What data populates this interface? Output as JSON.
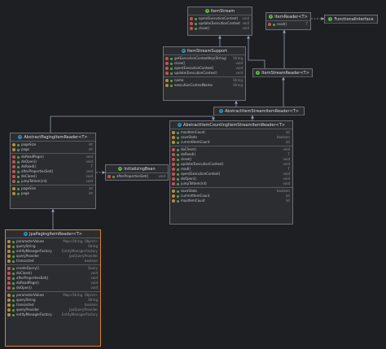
{
  "colors": {
    "background": "#1e1f22",
    "box": "#2b2d30",
    "border": "#6b6f76",
    "focus_border": "#d9822b",
    "edge": "#8fa0b8",
    "method_icon": "#c75450",
    "field_icon": "#b88c3b",
    "interface_icon": "#62b543",
    "class_icon": "#3592c4"
  },
  "icons": {
    "interface": "green-circle-icon",
    "class": "blue-circle-icon",
    "method": "red-circle-method-icon",
    "field": "orange-circle-field-icon"
  },
  "boxes": {
    "item_stream": {
      "title": "ItemStream",
      "sections": [
        [
          {
            "kind": "m",
            "name": "open(ExecutionContext)",
            "type": "void"
          },
          {
            "kind": "m",
            "name": "update(ExecutionContext)",
            "type": "void"
          },
          {
            "kind": "m",
            "name": "close()",
            "type": "void"
          }
        ]
      ]
    },
    "item_reader": {
      "title": "ItemReader<T>",
      "sections": [
        [
          {
            "kind": "m",
            "name": "read()",
            "type": "T"
          }
        ]
      ]
    },
    "functional_interface": {
      "title": "FunctionalInterface",
      "sections": []
    },
    "item_stream_support": {
      "title": "ItemStreamSupport",
      "sections": [
        [
          {
            "kind": "m",
            "name": "getExecutionContextKey(String)",
            "type": "String"
          },
          {
            "kind": "m",
            "name": "close()",
            "type": "void"
          },
          {
            "kind": "m",
            "name": "open(ExecutionContext)",
            "type": "void"
          },
          {
            "kind": "m",
            "name": "update(ExecutionContext)",
            "type": "void"
          }
        ],
        [
          {
            "kind": "f",
            "name": "name",
            "type": "String"
          },
          {
            "kind": "f",
            "name": "executionContextName",
            "type": "String"
          }
        ]
      ]
    },
    "item_stream_reader": {
      "title": "ItemStreamReader<T>",
      "sections": []
    },
    "abstract_item_stream_item_reader": {
      "title": "AbstractItemStreamItemReader<T>",
      "sections": []
    },
    "abstract_paging_item_reader": {
      "title": "AbstractPagingItemReader<T>",
      "sections": [
        [
          {
            "kind": "f",
            "name": "pageSize",
            "type": "int"
          },
          {
            "kind": "f",
            "name": "page",
            "type": "int"
          }
        ],
        [
          {
            "kind": "m",
            "name": "doReadPage()",
            "type": "void"
          },
          {
            "kind": "m",
            "name": "doOpen()",
            "type": "void"
          },
          {
            "kind": "m",
            "name": "doRead()",
            "type": "T"
          },
          {
            "kind": "m",
            "name": "afterPropertiesSet()",
            "type": "void"
          },
          {
            "kind": "m",
            "name": "doClose()",
            "type": "void"
          },
          {
            "kind": "m",
            "name": "jumpToItem(int)",
            "type": "void"
          }
        ],
        [
          {
            "kind": "f",
            "name": "pageSize",
            "type": "int"
          },
          {
            "kind": "f",
            "name": "page",
            "type": "int"
          }
        ]
      ]
    },
    "initializing_bean": {
      "title": "InitializingBean",
      "sections": [
        [
          {
            "kind": "m",
            "name": "afterPropertiesSet()",
            "type": "void"
          }
        ]
      ]
    },
    "abstract_item_counting_item_stream_item_reader": {
      "title": "AbstractItemCountingItemStreamItemReader<T>",
      "sections": [
        [
          {
            "kind": "f",
            "name": "maxItemCount",
            "type": "int"
          },
          {
            "kind": "f",
            "name": "saveState",
            "type": "boolean"
          },
          {
            "kind": "f",
            "name": "currentItemCount",
            "type": "int"
          }
        ],
        [
          {
            "kind": "m",
            "name": "doClose()",
            "type": "void"
          },
          {
            "kind": "m",
            "name": "doRead()",
            "type": "T"
          },
          {
            "kind": "m",
            "name": "close()",
            "type": "void"
          },
          {
            "kind": "m",
            "name": "update(ExecutionContext)",
            "type": "void"
          },
          {
            "kind": "m",
            "name": "read()",
            "type": "T"
          },
          {
            "kind": "m",
            "name": "open(ExecutionContext)",
            "type": "void"
          },
          {
            "kind": "m",
            "name": "doOpen()",
            "type": "void"
          },
          {
            "kind": "m",
            "name": "jumpToItem(int)",
            "type": "void"
          }
        ],
        [
          {
            "kind": "f",
            "name": "saveState",
            "type": "boolean"
          },
          {
            "kind": "f",
            "name": "currentItemCount",
            "type": "int"
          },
          {
            "kind": "f",
            "name": "maxItemCount",
            "type": "int"
          }
        ]
      ]
    },
    "jpa_paging_item_reader": {
      "title": "JpaPagingItemReader<T>",
      "sections": [
        [
          {
            "kind": "f",
            "name": "parameterValues",
            "type": "Map<String, Object>"
          },
          {
            "kind": "f",
            "name": "queryString",
            "type": "String"
          },
          {
            "kind": "f",
            "name": "entityManagerFactory",
            "type": "EntityManagerFactory"
          },
          {
            "kind": "f",
            "name": "queryProvider",
            "type": "JpaQueryProvider"
          },
          {
            "kind": "f",
            "name": "transacted",
            "type": "boolean"
          }
        ],
        [
          {
            "kind": "m",
            "name": "createQuery()",
            "type": "Query"
          },
          {
            "kind": "m",
            "name": "doClose()",
            "type": "void"
          },
          {
            "kind": "m",
            "name": "afterPropertiesSet()",
            "type": "void"
          },
          {
            "kind": "m",
            "name": "doReadPage()",
            "type": "void"
          },
          {
            "kind": "m",
            "name": "doOpen()",
            "type": "void"
          }
        ],
        [
          {
            "kind": "f",
            "name": "parameterValues",
            "type": "Map<String, Object>"
          },
          {
            "kind": "f",
            "name": "queryString",
            "type": "String"
          },
          {
            "kind": "f",
            "name": "transacted",
            "type": "boolean"
          },
          {
            "kind": "f",
            "name": "queryProvider",
            "type": "JpaQueryProvider"
          },
          {
            "kind": "f",
            "name": "entityManagerFactory",
            "type": "EntityManagerFactory"
          }
        ]
      ]
    }
  }
}
